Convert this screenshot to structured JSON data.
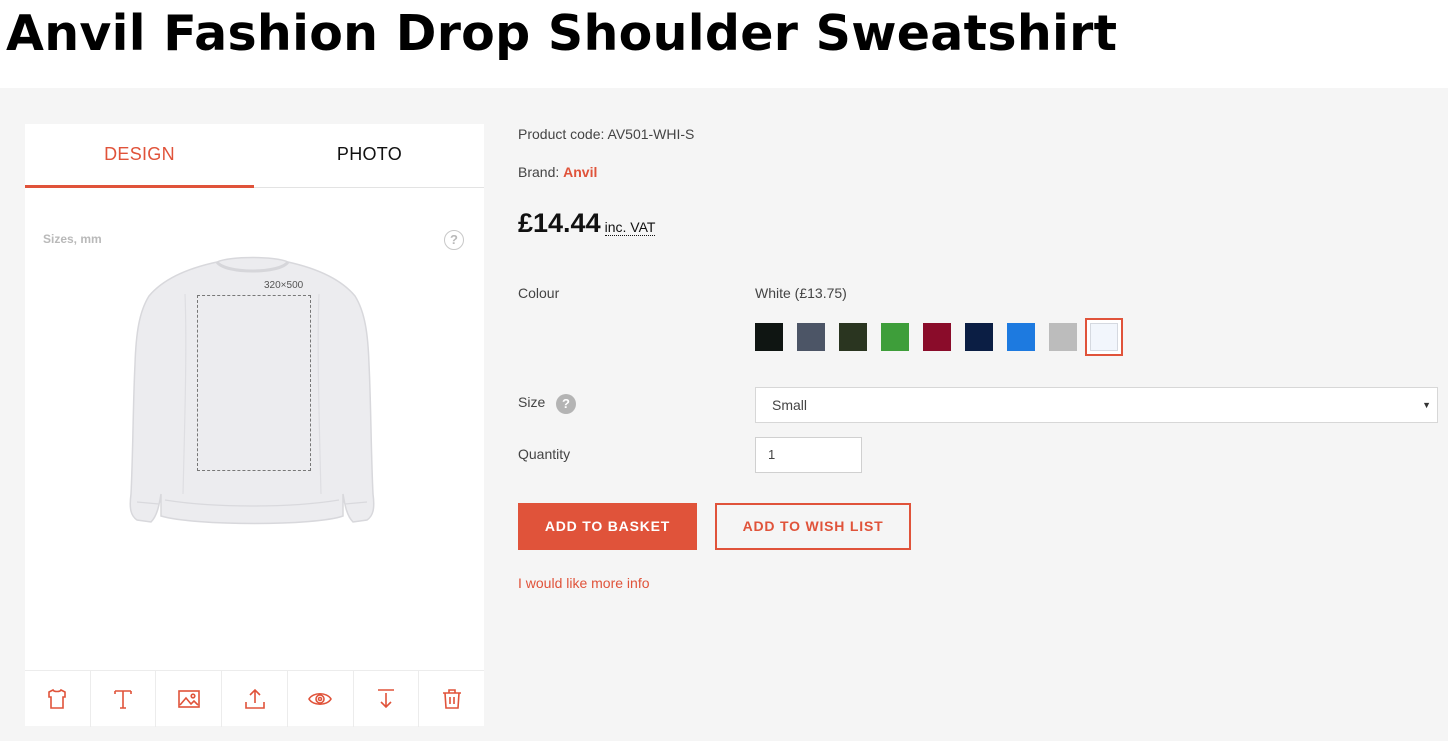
{
  "page": {
    "title": "Anvil Fashion Drop Shoulder Sweatshirt"
  },
  "designer": {
    "tabs": [
      {
        "label": "DESIGN",
        "active": true
      },
      {
        "label": "PHOTO",
        "active": false
      }
    ],
    "sizes_label": "Sizes, mm",
    "help_symbol": "?",
    "print_area_label": "320×500",
    "tools": [
      {
        "icon": "tshirt-icon"
      },
      {
        "icon": "text-icon"
      },
      {
        "icon": "image-icon"
      },
      {
        "icon": "upload-icon"
      },
      {
        "icon": "eye-icon"
      },
      {
        "icon": "download-icon"
      },
      {
        "icon": "trash-icon"
      }
    ]
  },
  "product": {
    "code_label": "Product code:",
    "code": "AV501-WHI-S",
    "brand_label": "Brand:",
    "brand": "Anvil",
    "price": "£14.44",
    "vat_label": "inc. VAT",
    "colour_label": "Colour",
    "colour_value": "White (£13.75)",
    "swatches": [
      {
        "name": "black",
        "color": "#0f1512"
      },
      {
        "name": "charcoal",
        "color": "#4c5566"
      },
      {
        "name": "dark-olive",
        "color": "#2a3520"
      },
      {
        "name": "green",
        "color": "#3e9e3a"
      },
      {
        "name": "burgundy",
        "color": "#8a0c2a"
      },
      {
        "name": "navy",
        "color": "#0b1e44"
      },
      {
        "name": "royal-blue",
        "color": "#1d7ae0"
      },
      {
        "name": "grey",
        "color": "#bcbcbc"
      },
      {
        "name": "white",
        "color": "#f2f6fc",
        "selected": true
      }
    ],
    "size_label": "Size",
    "size_help": "?",
    "size_value": "Small",
    "size_caret": "▼",
    "quantity_label": "Quantity",
    "quantity_value": "1",
    "add_to_basket": "ADD TO BASKET",
    "add_to_wishlist": "ADD TO WISH LIST",
    "more_info": "I would like more info"
  },
  "colors": {
    "accent": "#e0533a",
    "panel_bg": "#f5f5f5"
  }
}
